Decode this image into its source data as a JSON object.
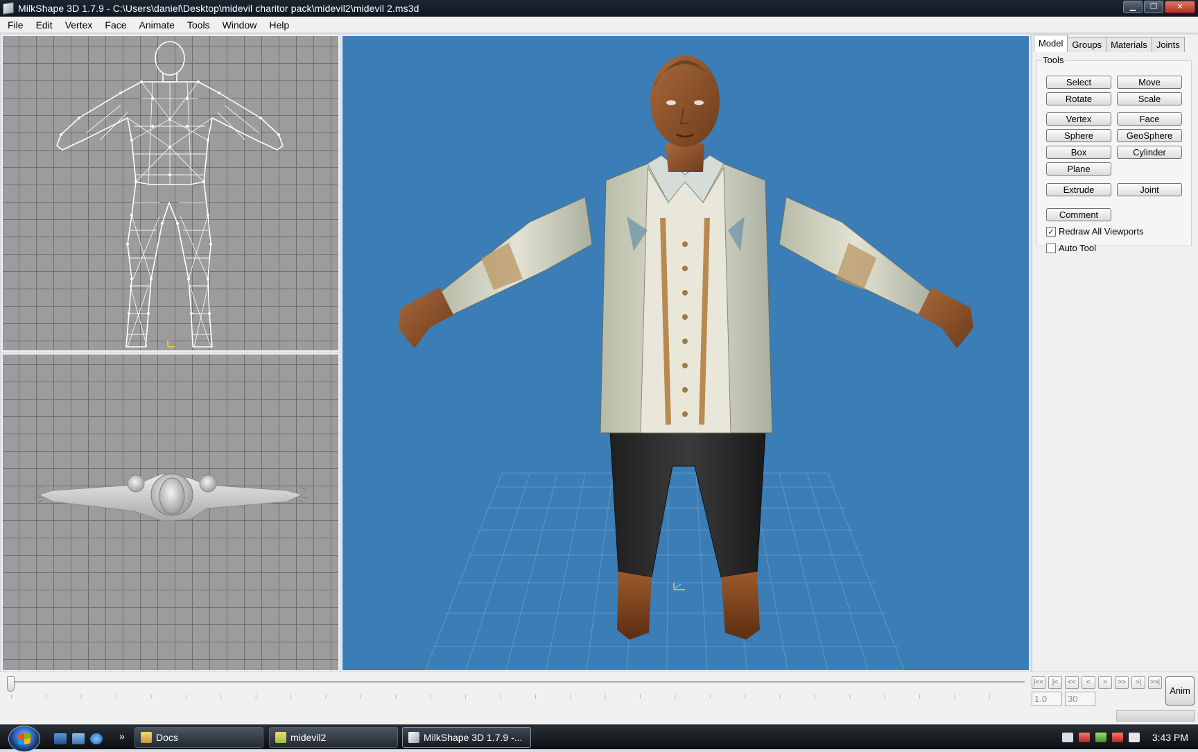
{
  "window": {
    "title": "MilkShape 3D 1.7.9 - C:\\Users\\daniel\\Desktop\\midevil charitor pack\\midevil2\\midevil 2.ms3d",
    "controls": [
      "▁",
      "❐",
      "✕"
    ]
  },
  "menu": [
    "File",
    "Edit",
    "Vertex",
    "Face",
    "Animate",
    "Tools",
    "Window",
    "Help"
  ],
  "panel": {
    "tabs": [
      "Model",
      "Groups",
      "Materials",
      "Joints"
    ],
    "active_tab": "Model",
    "group_label": "Tools",
    "buttons": {
      "select": "Select",
      "move": "Move",
      "rotate": "Rotate",
      "scale": "Scale",
      "vertex": "Vertex",
      "face": "Face",
      "sphere": "Sphere",
      "geosphere": "GeoSphere",
      "box": "Box",
      "cylinder": "Cylinder",
      "plane": "Plane",
      "extrude": "Extrude",
      "joint": "Joint",
      "comment": "Comment"
    },
    "checkboxes": {
      "redraw_all": {
        "label": "Redraw All Viewports",
        "checked": true
      },
      "auto_tool": {
        "label": "Auto Tool",
        "checked": false
      }
    }
  },
  "timeline": {
    "nav": [
      "|<<",
      "|<",
      "<<",
      "<",
      ">",
      ">>",
      ">|",
      ">>|"
    ],
    "start_frame": "1.0",
    "end_frame": "30",
    "anim_label": "Anim"
  },
  "taskbar": {
    "tasks": [
      {
        "label": "Docs"
      },
      {
        "label": "midevil2"
      },
      {
        "label": "MilkShape 3D 1.7.9 -..."
      }
    ],
    "clock": "3:43 PM"
  },
  "colors": {
    "viewport_3d_bg": "#3a7db7",
    "ortho_grid_bg": "#9c9c9c",
    "title_bar": "#0f1720"
  }
}
